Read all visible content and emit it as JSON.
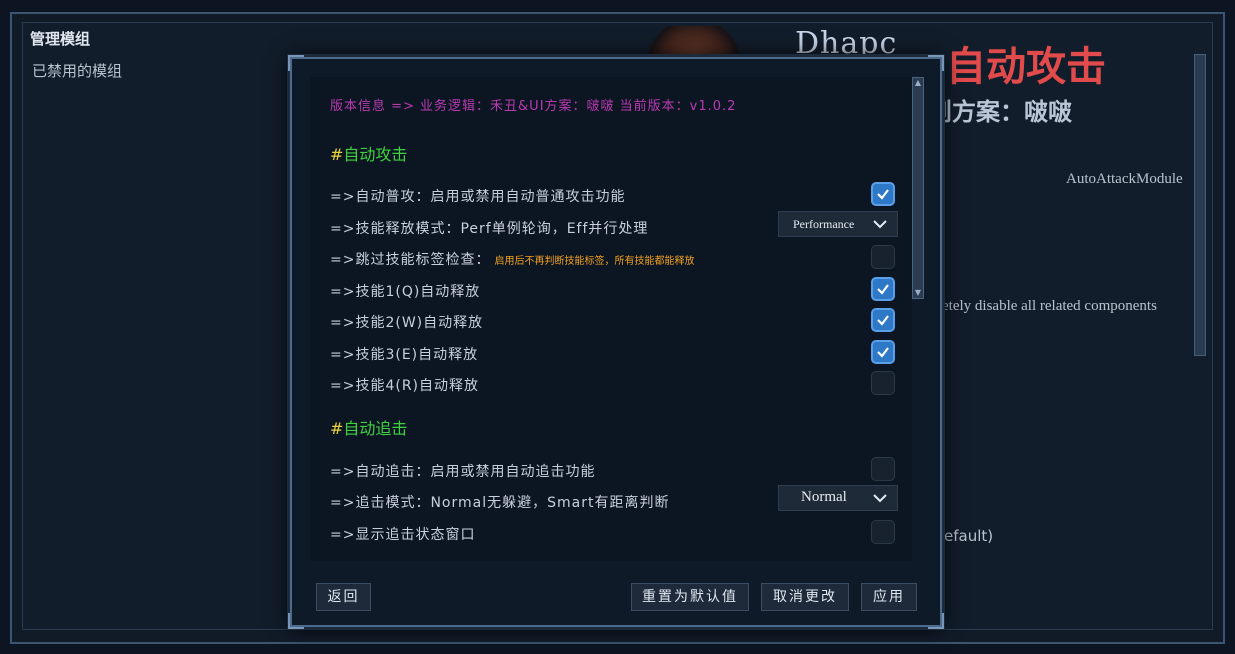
{
  "sidebar": {
    "title": "管理模组",
    "disabled_modules": "已禁用的模组"
  },
  "background": {
    "logo_text": "Dhapc",
    "title": "自动攻击",
    "subtitle": "则方案：啵啵",
    "module_id": "AutoAttackModule",
    "disable_text": "etely disable all related components",
    "default_text": "efault)"
  },
  "dialog": {
    "version": "版本信息 => 业务逻辑：禾丑&UI方案：啵啵 当前版本：v1.0.2",
    "sections": [
      {
        "title": "#自动攻击"
      },
      {
        "title": "#自动追击"
      }
    ],
    "attack_rows": [
      {
        "label": "=>自动普攻：启用或禁用自动普通攻击功能",
        "checked": true
      },
      {
        "label": "=>技能释放模式：Perf单例轮询，Eff并行处理",
        "select": "Performance"
      },
      {
        "label": "=>跳过技能标签检查：",
        "note": "启用后不再判断技能标签，所有技能都能释放",
        "checked": false
      },
      {
        "label": "=>技能1(Q)自动释放",
        "checked": true
      },
      {
        "label": "=>技能2(W)自动释放",
        "checked": true
      },
      {
        "label": "=>技能3(E)自动释放",
        "checked": true
      },
      {
        "label": "=>技能4(R)自动释放",
        "checked": false
      }
    ],
    "chase_rows": [
      {
        "label": "=>自动追击：启用或禁用自动追击功能",
        "checked": false
      },
      {
        "label": "=>追击模式：Normal无躲避，Smart有距离判断",
        "select": "Normal"
      },
      {
        "label": "=>显示追击状态窗口",
        "checked": false
      }
    ],
    "buttons": {
      "back": "返回",
      "reset": "重置为默认值",
      "cancel": "取消更改",
      "apply": "应用"
    }
  },
  "colors": {
    "accent": "#2e78c8",
    "section": "#3fd13f",
    "version": "#b83ab0",
    "note": "#f0a020",
    "bg_title": "#e24b4b"
  },
  "icons": [
    "check-icon",
    "chevron-down-icon",
    "scroll-up-icon",
    "scroll-down-icon"
  ]
}
